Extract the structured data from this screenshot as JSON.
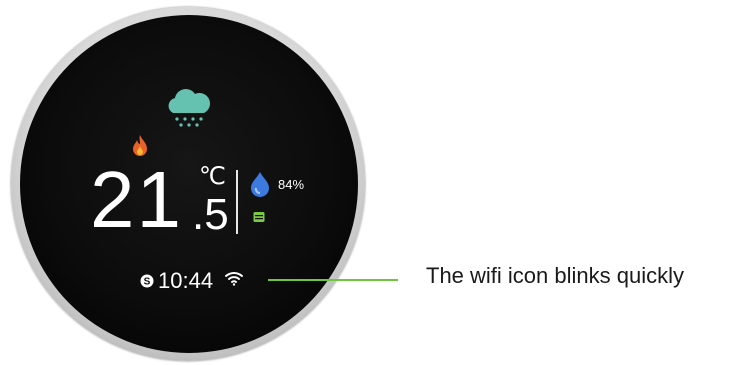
{
  "thermostat": {
    "icons": {
      "weather": "cloud-rain-icon",
      "mode": "flame-icon",
      "humidity": "water-drop-icon",
      "schedule": "calendar-icon",
      "clock_mode": "mode-s-icon",
      "wifi": "wifi-icon"
    },
    "temperature": {
      "integer": "21",
      "decimal": ".5",
      "unit": "℃"
    },
    "humidity": "84%",
    "time": "10:44",
    "colors": {
      "weather_icon": "#66c2b0",
      "flame": "#e8602a",
      "humidity_icon": "#3d7ae0",
      "schedule_icon": "#7ac943",
      "callout_line": "#6fc53f"
    }
  },
  "callout": {
    "text": "The wifi icon blinks quickly"
  }
}
